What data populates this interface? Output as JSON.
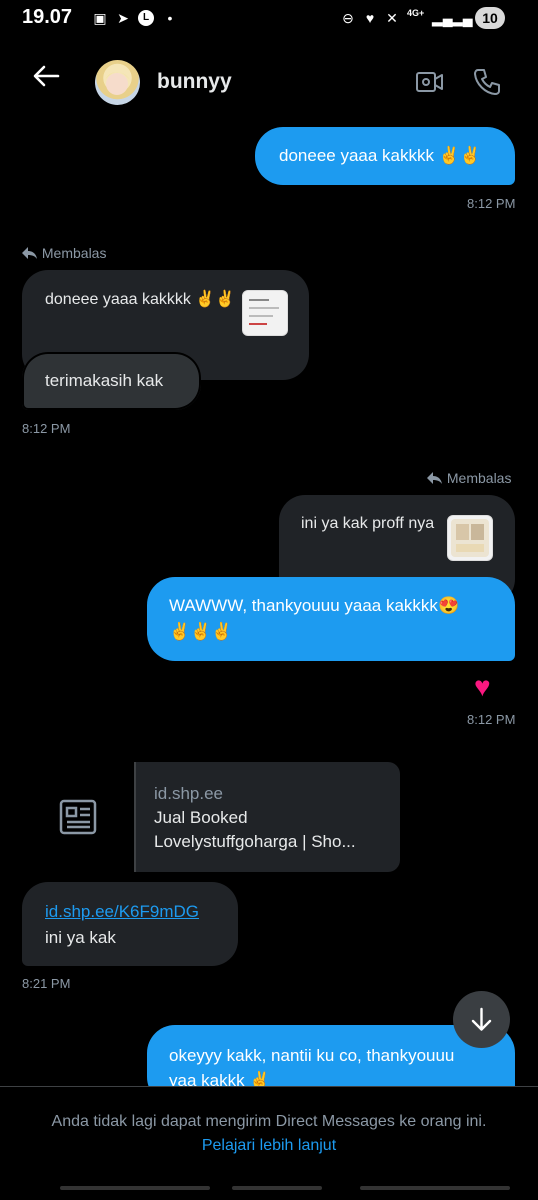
{
  "status_bar": {
    "time": "19.07",
    "battery": "10",
    "network": "4G+"
  },
  "header": {
    "contact_name": "bunnyy"
  },
  "messages": {
    "m1": {
      "text": "doneee yaaa kakkkk",
      "emoji": "✌️✌️",
      "time": "8:12 PM"
    },
    "reply1": {
      "label": "Membalas",
      "quoted_text": "doneee yaaa kakkkk",
      "quoted_emoji": "✌️✌️"
    },
    "m2": {
      "text": "terimakasih kak",
      "time": "8:12 PM"
    },
    "reply2": {
      "label": "Membalas",
      "quoted_text": "ini ya kak proff nya"
    },
    "m3": {
      "text": "WAWWW, thankyouuu yaaa kakkkk",
      "emoji_inline": "😍",
      "emoji_line": "✌️✌️✌️",
      "reaction": "♥",
      "time": "8:12 PM"
    },
    "card": {
      "domain": "id.shp.ee",
      "title_line1": "Jual Booked",
      "title_line2": "Lovelystuffgoharga | Sho..."
    },
    "m4": {
      "link": "id.shp.ee/K6F9mDG",
      "text": "ini ya kak",
      "time": "8:21 PM"
    },
    "m5": {
      "text_line1": "okeyyy kakk, nantii ku co, thankyouuu",
      "text_line2": "yaa kakkk",
      "emoji": "✌️"
    }
  },
  "footer": {
    "notice": "Anda tidak lagi dapat mengirim Direct Messages ke orang ini.",
    "learn_more": "Pelajari lebih lanjut"
  },
  "icons": {
    "back": "arrow-left-icon",
    "video": "video-call-icon",
    "phone": "phone-icon",
    "reply": "reply-arrow-icon",
    "article": "article-icon",
    "scroll": "arrow-down-icon"
  },
  "colors": {
    "accent": "#1d9bf0",
    "bubble_dark": "#202327",
    "background": "#000000",
    "heart": "#f91880"
  }
}
